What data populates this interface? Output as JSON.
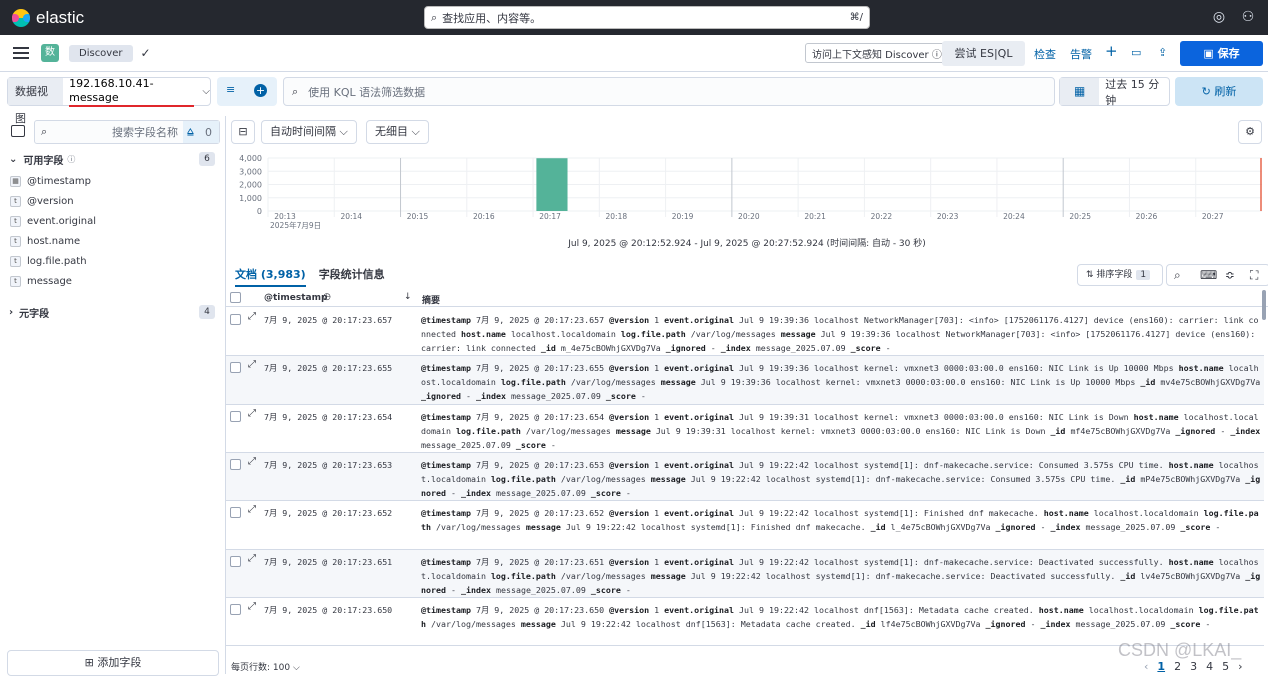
{
  "topbar": {
    "brand": "elastic",
    "search_placeholder": "查找应用、内容等。",
    "search_shortcut": "⌘/"
  },
  "nav": {
    "space": "数",
    "breadcrumb": "Discover",
    "context_link": "访问上下文感知 Discover ⓘ",
    "esql": "尝试 ES|QL",
    "inspect": "检查",
    "alerts": "告警",
    "save": "保存"
  },
  "query": {
    "dataview_label": "数据视图",
    "dataview": "192.168.10.41-message",
    "placeholder": "使用 KQL 语法筛选数据",
    "time": "过去 15 分钟",
    "refresh": "刷新"
  },
  "sidebar": {
    "search_placeholder": "搜索字段名称",
    "filter_count": "0",
    "available_label": "可用字段",
    "available_count": "6",
    "fields": [
      {
        "name": "@timestamp",
        "type": "date"
      },
      {
        "name": "@version",
        "type": "t"
      },
      {
        "name": "event.original",
        "type": "t"
      },
      {
        "name": "host.name",
        "type": "t"
      },
      {
        "name": "log.file.path",
        "type": "t"
      },
      {
        "name": "message",
        "type": "t"
      }
    ],
    "meta_label": "元字段",
    "meta_count": "4",
    "add_field": "添加字段"
  },
  "toolbar": {
    "interval": "自动时间间隔",
    "breakdown": "无细目"
  },
  "chart_data": {
    "type": "bar",
    "ylim": [
      0,
      4000
    ],
    "yticks": [
      "4,000",
      "3,000",
      "2,000",
      "1,000",
      "0"
    ],
    "xticks": [
      "20:13",
      "20:14",
      "20:15",
      "20:16",
      "20:17",
      "20:18",
      "20:19",
      "20:20",
      "20:21",
      "20:22",
      "20:23",
      "20:24",
      "20:25",
      "20:26",
      "20:27"
    ],
    "xsub": "2025年7月9日",
    "bars": [
      {
        "x": "20:17",
        "value": 3983
      }
    ],
    "color": "#54b399"
  },
  "range_text": "Jul 9, 2025 @ 20:12:52.924 - Jul 9, 2025 @ 20:27:52.924  (时间间隔: 自动 - 30 秒)",
  "tabs": {
    "docs": "文档 (3,983)",
    "stats": "字段统计信息"
  },
  "sort": {
    "label": "排序字段",
    "count": "1"
  },
  "table": {
    "col_time": "@timestamp",
    "col_summary": "摘要"
  },
  "rows": [
    {
      "ts": "7月 9, 2025 @ 20:17:23.657",
      "doc": [
        [
          "@timestamp",
          "7月 9, 2025 @ 20:17:23.657"
        ],
        [
          "@version",
          "1"
        ],
        [
          "event.original",
          "Jul 9 19:39:36 localhost NetworkManager[703]: <info> [1752061176.4127] device (ens160): carrier: link connected"
        ],
        [
          "host.name",
          "localhost.localdomain"
        ],
        [
          "log.file.path",
          "/var/log/messages"
        ],
        [
          "message",
          "Jul 9 19:39:36 localhost NetworkManager[703]: <info> [1752061176.4127] device (ens160): carrier: link connected"
        ],
        [
          "_id",
          "m_4e75cBOWhjGXVDg7Va"
        ],
        [
          "_ignored",
          "-"
        ],
        [
          "_index",
          "message_2025.07.09"
        ],
        [
          "_score",
          "-"
        ]
      ]
    },
    {
      "ts": "7月 9, 2025 @ 20:17:23.655",
      "doc": [
        [
          "@timestamp",
          "7月 9, 2025 @ 20:17:23.655"
        ],
        [
          "@version",
          "1"
        ],
        [
          "event.original",
          "Jul 9 19:39:36 localhost kernel: vmxnet3 0000:03:00.0 ens160: NIC Link is Up 10000 Mbps"
        ],
        [
          "host.name",
          "localhost.localdomain"
        ],
        [
          "log.file.path",
          "/var/log/messages"
        ],
        [
          "message",
          "Jul 9 19:39:36 localhost kernel: vmxnet3 0000:03:00.0 ens160: NIC Link is Up 10000 Mbps"
        ],
        [
          "_id",
          "mv4e75cBOWhjGXVDg7Va"
        ],
        [
          "_ignored",
          "-"
        ],
        [
          "_index",
          "message_2025.07.09"
        ],
        [
          "_score",
          "-"
        ]
      ]
    },
    {
      "ts": "7月 9, 2025 @ 20:17:23.654",
      "doc": [
        [
          "@timestamp",
          "7月 9, 2025 @ 20:17:23.654"
        ],
        [
          "@version",
          "1"
        ],
        [
          "event.original",
          "Jul 9 19:39:31 localhost kernel: vmxnet3 0000:03:00.0 ens160: NIC Link is Down"
        ],
        [
          "host.name",
          "localhost.localdomain"
        ],
        [
          "log.file.path",
          "/var/log/messages"
        ],
        [
          "message",
          "Jul 9 19:39:31 localhost kernel: vmxnet3 0000:03:00.0 ens160: NIC Link is Down"
        ],
        [
          "_id",
          "mf4e75cBOWhjGXVDg7Va"
        ],
        [
          "_ignored",
          "-"
        ],
        [
          "_index",
          "message_2025.07.09"
        ],
        [
          "_score",
          "-"
        ]
      ]
    },
    {
      "ts": "7月 9, 2025 @ 20:17:23.653",
      "doc": [
        [
          "@timestamp",
          "7月 9, 2025 @ 20:17:23.653"
        ],
        [
          "@version",
          "1"
        ],
        [
          "event.original",
          "Jul 9 19:22:42 localhost systemd[1]: dnf-makecache.service: Consumed 3.575s CPU time."
        ],
        [
          "host.name",
          "localhost.localdomain"
        ],
        [
          "log.file.path",
          "/var/log/messages"
        ],
        [
          "message",
          "Jul 9 19:22:42 localhost systemd[1]: dnf-makecache.service: Consumed 3.575s CPU time."
        ],
        [
          "_id",
          "mP4e75cBOWhjGXVDg7Va"
        ],
        [
          "_ignored",
          "-"
        ],
        [
          "_index",
          "message_2025.07.09"
        ],
        [
          "_score",
          "-"
        ]
      ]
    },
    {
      "ts": "7月 9, 2025 @ 20:17:23.652",
      "doc": [
        [
          "@timestamp",
          "7月 9, 2025 @ 20:17:23.652"
        ],
        [
          "@version",
          "1"
        ],
        [
          "event.original",
          "Jul 9 19:22:42 localhost systemd[1]: Finished dnf makecache."
        ],
        [
          "host.name",
          "localhost.localdomain"
        ],
        [
          "log.file.path",
          "/var/log/messages"
        ],
        [
          "message",
          "Jul 9 19:22:42 localhost systemd[1]: Finished dnf makecache."
        ],
        [
          "_id",
          "l_4e75cBOWhjGXVDg7Va"
        ],
        [
          "_ignored",
          "-"
        ],
        [
          "_index",
          "message_2025.07.09"
        ],
        [
          "_score",
          "-"
        ]
      ]
    },
    {
      "ts": "7月 9, 2025 @ 20:17:23.651",
      "doc": [
        [
          "@timestamp",
          "7月 9, 2025 @ 20:17:23.651"
        ],
        [
          "@version",
          "1"
        ],
        [
          "event.original",
          "Jul 9 19:22:42 localhost systemd[1]: dnf-makecache.service: Deactivated successfully."
        ],
        [
          "host.name",
          "localhost.localdomain"
        ],
        [
          "log.file.path",
          "/var/log/messages"
        ],
        [
          "message",
          "Jul 9 19:22:42 localhost systemd[1]: dnf-makecache.service: Deactivated successfully."
        ],
        [
          "_id",
          "lv4e75cBOWhjGXVDg7Va"
        ],
        [
          "_ignored",
          "-"
        ],
        [
          "_index",
          "message_2025.07.09"
        ],
        [
          "_score",
          "-"
        ]
      ]
    },
    {
      "ts": "7月 9, 2025 @ 20:17:23.650",
      "doc": [
        [
          "@timestamp",
          "7月 9, 2025 @ 20:17:23.650"
        ],
        [
          "@version",
          "1"
        ],
        [
          "event.original",
          "Jul 9 19:22:42 localhost dnf[1563]: Metadata cache created."
        ],
        [
          "host.name",
          "localhost.localdomain"
        ],
        [
          "log.file.path",
          "/var/log/messages"
        ],
        [
          "message",
          "Jul 9 19:22:42 localhost dnf[1563]: Metadata cache created."
        ],
        [
          "_id",
          "lf4e75cBOWhjGXVDg7Va"
        ],
        [
          "_ignored",
          "-"
        ],
        [
          "_index",
          "message_2025.07.09"
        ],
        [
          "_score",
          "-"
        ]
      ]
    }
  ],
  "footer": {
    "rows_per_page": "每页行数: 100",
    "pages": [
      "1",
      "2",
      "3",
      "4",
      "5"
    ]
  },
  "watermark": "CSDN @LKAI_"
}
